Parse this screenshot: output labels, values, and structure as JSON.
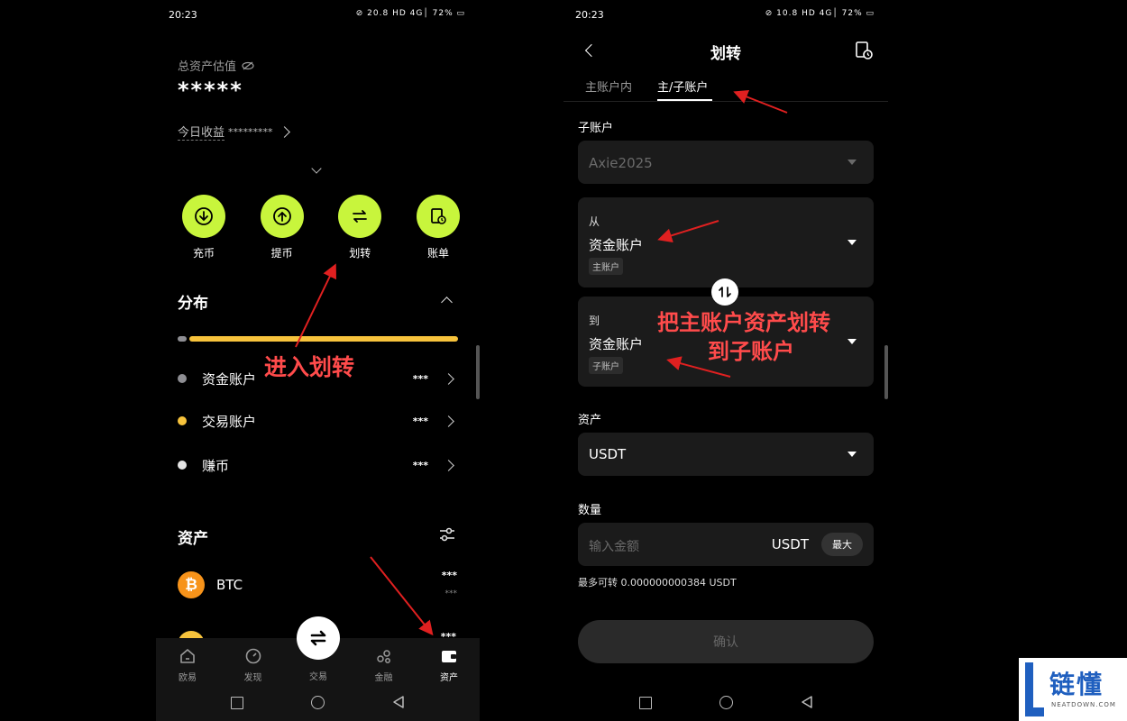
{
  "left": {
    "status_time": "20:23",
    "status_icons": "⊘ 20.8 HD 4G│ 72% ▭",
    "asset_label": "总资产估值",
    "asset_value": "*****",
    "today_label": "今日收益",
    "today_value": "*********",
    "actions": [
      {
        "label": "充币",
        "icon": "deposit-icon"
      },
      {
        "label": "提币",
        "icon": "withdraw-icon"
      },
      {
        "label": "划转",
        "icon": "transfer-icon"
      },
      {
        "label": "账单",
        "icon": "bill-icon"
      }
    ],
    "distribution_title": "分布",
    "accounts": [
      {
        "label": "资金账户",
        "value": "***",
        "color": "#8e8e93"
      },
      {
        "label": "交易账户",
        "value": "***",
        "color": "#f7c33c"
      },
      {
        "label": "赚币",
        "value": "***",
        "color": "#e5e5e5"
      }
    ],
    "assets_title": "资产",
    "btc_label": "BTC",
    "btc_value": "***",
    "btc_sub": "***",
    "second_value": "***",
    "nav": [
      "欧易",
      "发现",
      "交易",
      "金融",
      "资产"
    ],
    "annotation": "进入划转",
    "colors": {
      "accent": "#c8f53c",
      "bar": "#f7c33c",
      "btc": "#f7931a",
      "annotation": "#ff4b4b"
    }
  },
  "right": {
    "status_time": "20:23",
    "status_icons": "⊘ 10.8 HD 4G│ 72% ▭",
    "title": "划转",
    "tabs": [
      "主账户内",
      "主/子账户"
    ],
    "sub_label": "子账户",
    "sub_value": "Axie2025",
    "from_label": "从",
    "from_value": "资金账户",
    "from_tag": "主账户",
    "to_label": "到",
    "to_value": "资金账户",
    "to_tag": "子账户",
    "asset_label": "资产",
    "asset_value": "USDT",
    "qty_label": "数量",
    "qty_placeholder": "输入金额",
    "qty_unit": "USDT",
    "max_label": "最大",
    "avail_text": "最多可转 0.000000000384 USDT",
    "confirm_label": "确认",
    "annotation_line1": "把主账户资产划转",
    "annotation_line2": "到子账户"
  },
  "watermark": {
    "brand": "链懂",
    "sub": "NEATDOWN.COM"
  }
}
